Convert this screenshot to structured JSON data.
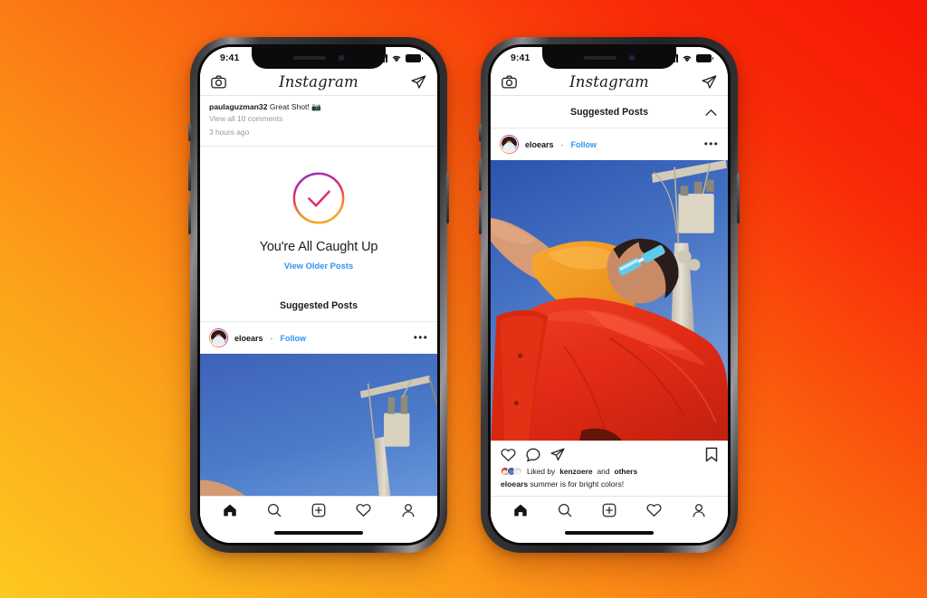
{
  "background": {
    "gradient_from": "#FDC91F",
    "gradient_to": "#F61505",
    "description": "orange-to-red diagonal gradient"
  },
  "brand": {
    "logo": "Instagram",
    "link_blue": "#2E95F4",
    "gradient_ring": "#F9CE34 → #EE2A7B → #6228D7"
  },
  "status_bar": {
    "time": "9:41",
    "signal_icon": "signal-bars-icon",
    "wifi_icon": "wifi-icon",
    "battery_icon": "battery-icon"
  },
  "app_header": {
    "camera_icon": "camera-icon",
    "title": "Instagram",
    "direct_icon": "paper-plane-icon"
  },
  "phone_left": {
    "label": "You're All Caught Up screen",
    "comment": {
      "username": "paulaguzman32",
      "text": "Great Shot! 📷",
      "view_comments": "View all 10 comments",
      "timestamp": "3 hours ago"
    },
    "caught_up": {
      "check_icon": "check-circle-gradient-icon",
      "title": "You're All Caught Up",
      "link": "View Older Posts"
    },
    "suggested_header": "Suggested Posts",
    "post": {
      "username": "eloears",
      "separator": "·",
      "follow": "Follow",
      "more_icon": "more-options-icon",
      "photo_alt": "Person in orange shirt and red overalls posing below a utility pole against a blue sky"
    }
  },
  "phone_right": {
    "label": "Suggested Posts screen",
    "suggested_header": "Suggested Posts",
    "collapse_icon": "chevron-up-icon",
    "post": {
      "username": "eloears",
      "separator": "·",
      "follow": "Follow",
      "more_icon": "more-options-icon",
      "photo_alt": "Person in orange shirt and red overalls posing below a utility pole against a blue sky"
    },
    "actions": {
      "like_icon": "heart-icon",
      "comment_icon": "comment-bubble-icon",
      "share_icon": "paper-plane-icon",
      "save_icon": "bookmark-icon"
    },
    "likes": {
      "prefix": "Liked by",
      "user": "kenzoere",
      "suffix_and": "and",
      "others": "others"
    },
    "caption": {
      "username": "eloears",
      "text": "summer is for bright colors!"
    }
  },
  "tab_bar": {
    "home_icon": "home-icon",
    "search_icon": "search-icon",
    "add_icon": "add-post-icon",
    "activity_icon": "heart-icon",
    "profile_icon": "profile-icon"
  }
}
